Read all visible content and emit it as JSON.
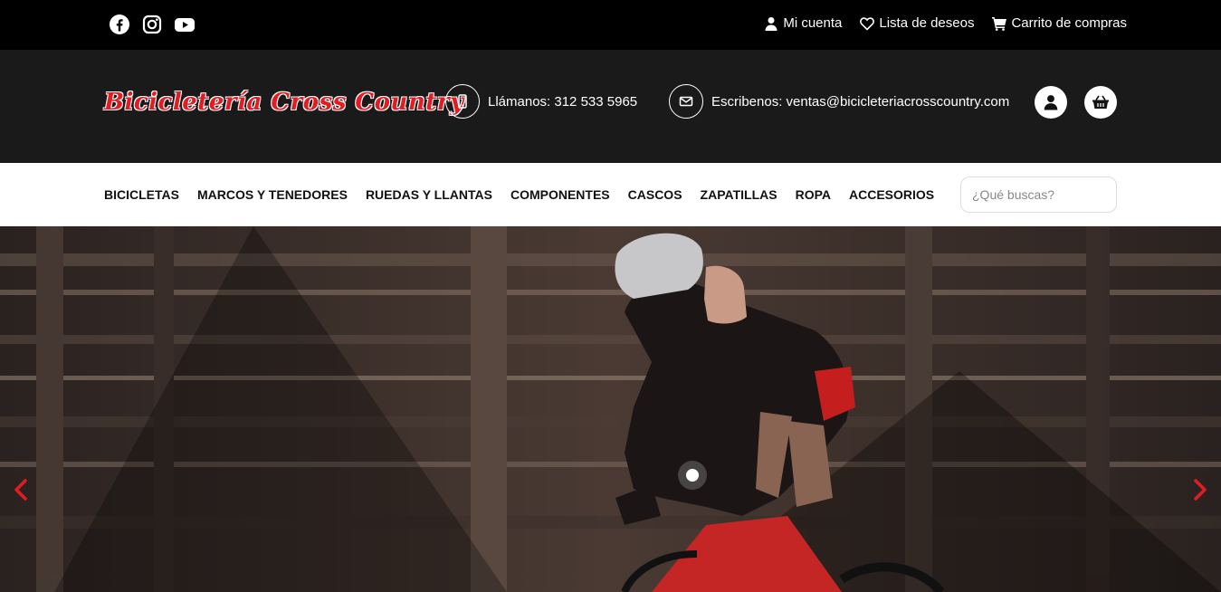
{
  "topbar": {
    "social": [
      "facebook-icon",
      "instagram-icon",
      "youtube-icon"
    ],
    "links": {
      "account": "Mi cuenta",
      "wishlist": "Lista de deseos",
      "cart": "Carrito de compras"
    }
  },
  "header": {
    "logo_text": "Bicicletería Cross Country",
    "phone_label": "Llámanos: 312 533 5965",
    "email_label": "Escribenos: ventas@bicicleteriacrosscountry.com",
    "icons": [
      "mobile-phone-icon",
      "envelope-icon",
      "user-icon",
      "basket-icon"
    ]
  },
  "nav": {
    "items": [
      "BICICLETAS",
      "MARCOS Y TENEDORES",
      "RUEDAS Y LLANTAS",
      "COMPONENTES",
      "CASCOS",
      "ZAPATILLAS",
      "ROPA",
      "ACCESORIOS"
    ],
    "search_placeholder": "¿Qué buscas?"
  },
  "hero": {
    "prev_icon": "chevron-left-icon",
    "next_icon": "chevron-right-icon"
  },
  "colors": {
    "brand_red": "#e31b23",
    "topbar_bg": "#000000",
    "header_bg": "#1a1a1a",
    "nav_bg": "#ffffff"
  }
}
